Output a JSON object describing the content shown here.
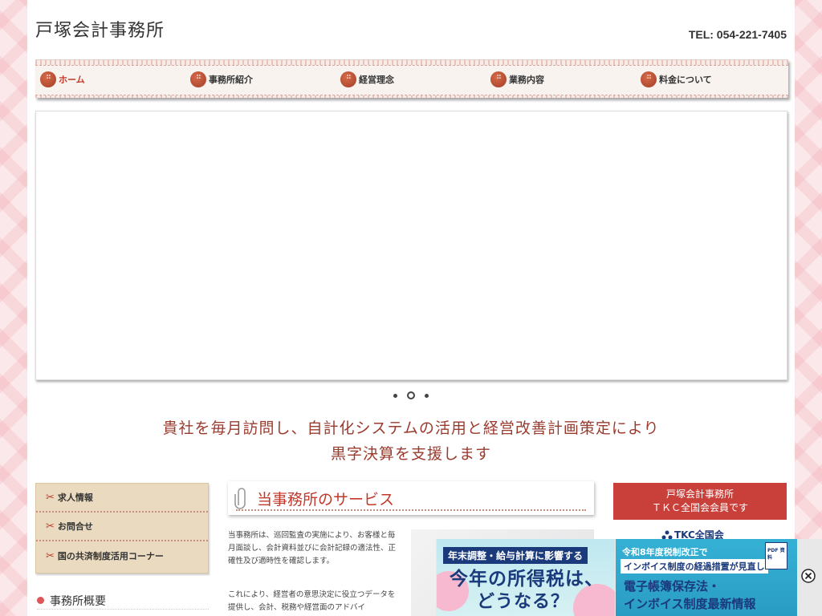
{
  "site": {
    "title": "戸塚会計事務所",
    "tel": "TEL: 054-221-7405"
  },
  "nav": {
    "items": [
      {
        "label": "ホーム",
        "active": true
      },
      {
        "label": "事務所紹介",
        "active": false
      },
      {
        "label": "経営理念",
        "active": false
      },
      {
        "label": "業務内容",
        "active": false
      },
      {
        "label": "料金について",
        "active": false
      }
    ]
  },
  "slider": {
    "dots": 3,
    "active_dot": 2
  },
  "catchphrase": {
    "line1": "貴社を毎月訪問し、自計化システムの活用と経営改善計画策定により",
    "line2": "黒字決算を支援します"
  },
  "left_menu": {
    "items": [
      {
        "label": "求人情報",
        "icon": "scissors-icon"
      },
      {
        "label": "お問合せ",
        "icon": "scissors-icon"
      },
      {
        "label": "国の共済制度活用コーナー",
        "icon": "scissors-icon"
      }
    ],
    "office_overview": "事務所概要"
  },
  "service": {
    "title": "当事務所のサービス",
    "para1": "当事務所は、巡回監査の実施により、お客様と毎月面談し、会計資料並びに会計記録の適法性、正確性及び適時性を確認します。",
    "para2": "これにより、経営者の意思決定に役立つデータを提供し、会計、税務や経営面のアドバイ"
  },
  "tkc": {
    "box_line1": "戸塚会計事務所",
    "box_line2": "ＴＫＣ全国会会員です",
    "logo_text": "TKC全国会"
  },
  "ad": {
    "left_line1": "年末調整・給与計算に影響する",
    "left_line2": "今年の所得税は、",
    "left_line3": "どうなる？",
    "right_line1": "令和8年度税制改正で",
    "right_line2": "インボイス制度の経過措置が見直し",
    "right_line3": "電子帳簿保存法・",
    "right_line4": "インボイス制度最新情報",
    "doc_label": "PDF 資料"
  },
  "colors": {
    "accent_red": "#c0392b",
    "nav_button": "#a23e26",
    "catch_text": "#9a3b2e",
    "menu_bg": "#eadbc0",
    "tkc_box": "#c9403a"
  }
}
